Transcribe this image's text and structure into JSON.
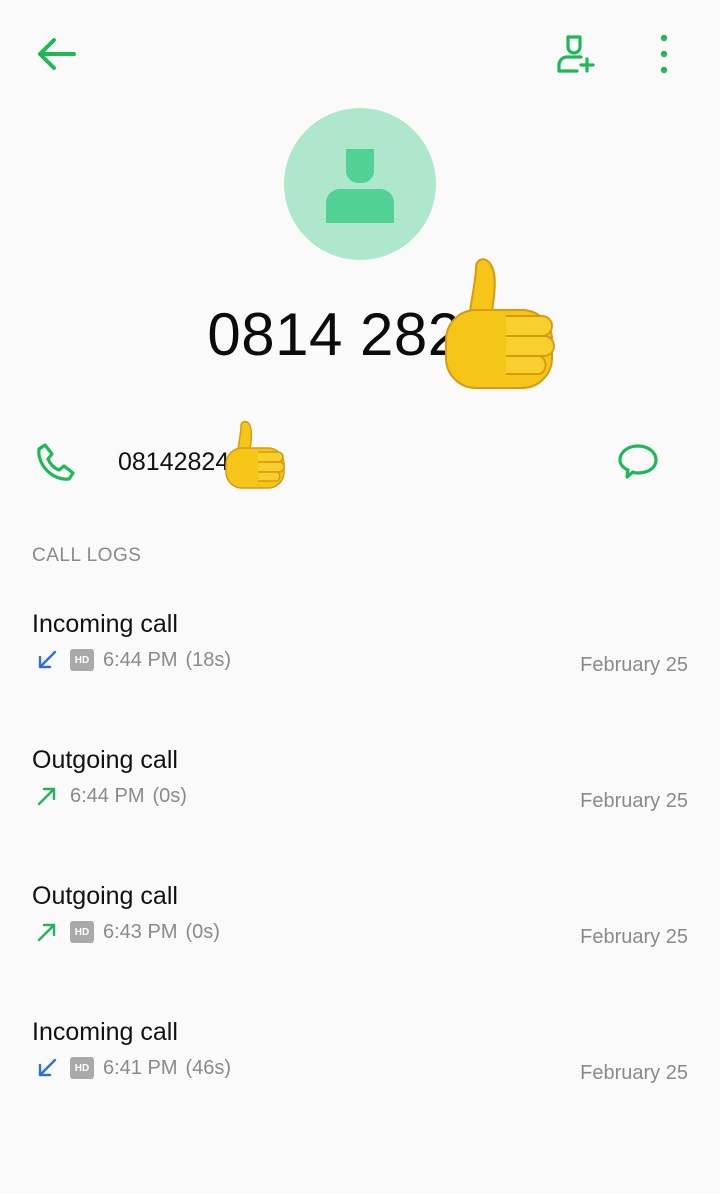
{
  "header": {
    "back_icon": "arrow-left-icon",
    "add_contact_icon": "person-add-icon",
    "more_icon": "more-vertical-icon"
  },
  "contact": {
    "avatar_icon": "person-icon",
    "display_number": "0814 282 4",
    "number": "08142824"
  },
  "actions": {
    "call_icon": "phone-icon",
    "message_icon": "message-bubble-icon"
  },
  "section_title": "CALL LOGS",
  "call_logs": [
    {
      "type": "Incoming call",
      "direction": "incoming",
      "hd": true,
      "time": "6:44 PM",
      "duration": "(18s)",
      "date": "February 25"
    },
    {
      "type": "Outgoing call",
      "direction": "outgoing",
      "hd": false,
      "time": "6:44 PM",
      "duration": "(0s)",
      "date": "February 25"
    },
    {
      "type": "Outgoing call",
      "direction": "outgoing",
      "hd": true,
      "time": "6:43 PM",
      "duration": "(0s)",
      "date": "February 25"
    },
    {
      "type": "Incoming call",
      "direction": "incoming",
      "hd": true,
      "time": "6:41 PM",
      "duration": "(46s)",
      "date": "February 25"
    }
  ],
  "hd_label": "HD",
  "colors": {
    "accent": "#1db954",
    "avatar_bg": "#aee7cc",
    "avatar_fg": "#52d195",
    "incoming": "#2f6fdb",
    "outgoing": "#24b35a",
    "secondary_text": "#8a8a8a"
  }
}
